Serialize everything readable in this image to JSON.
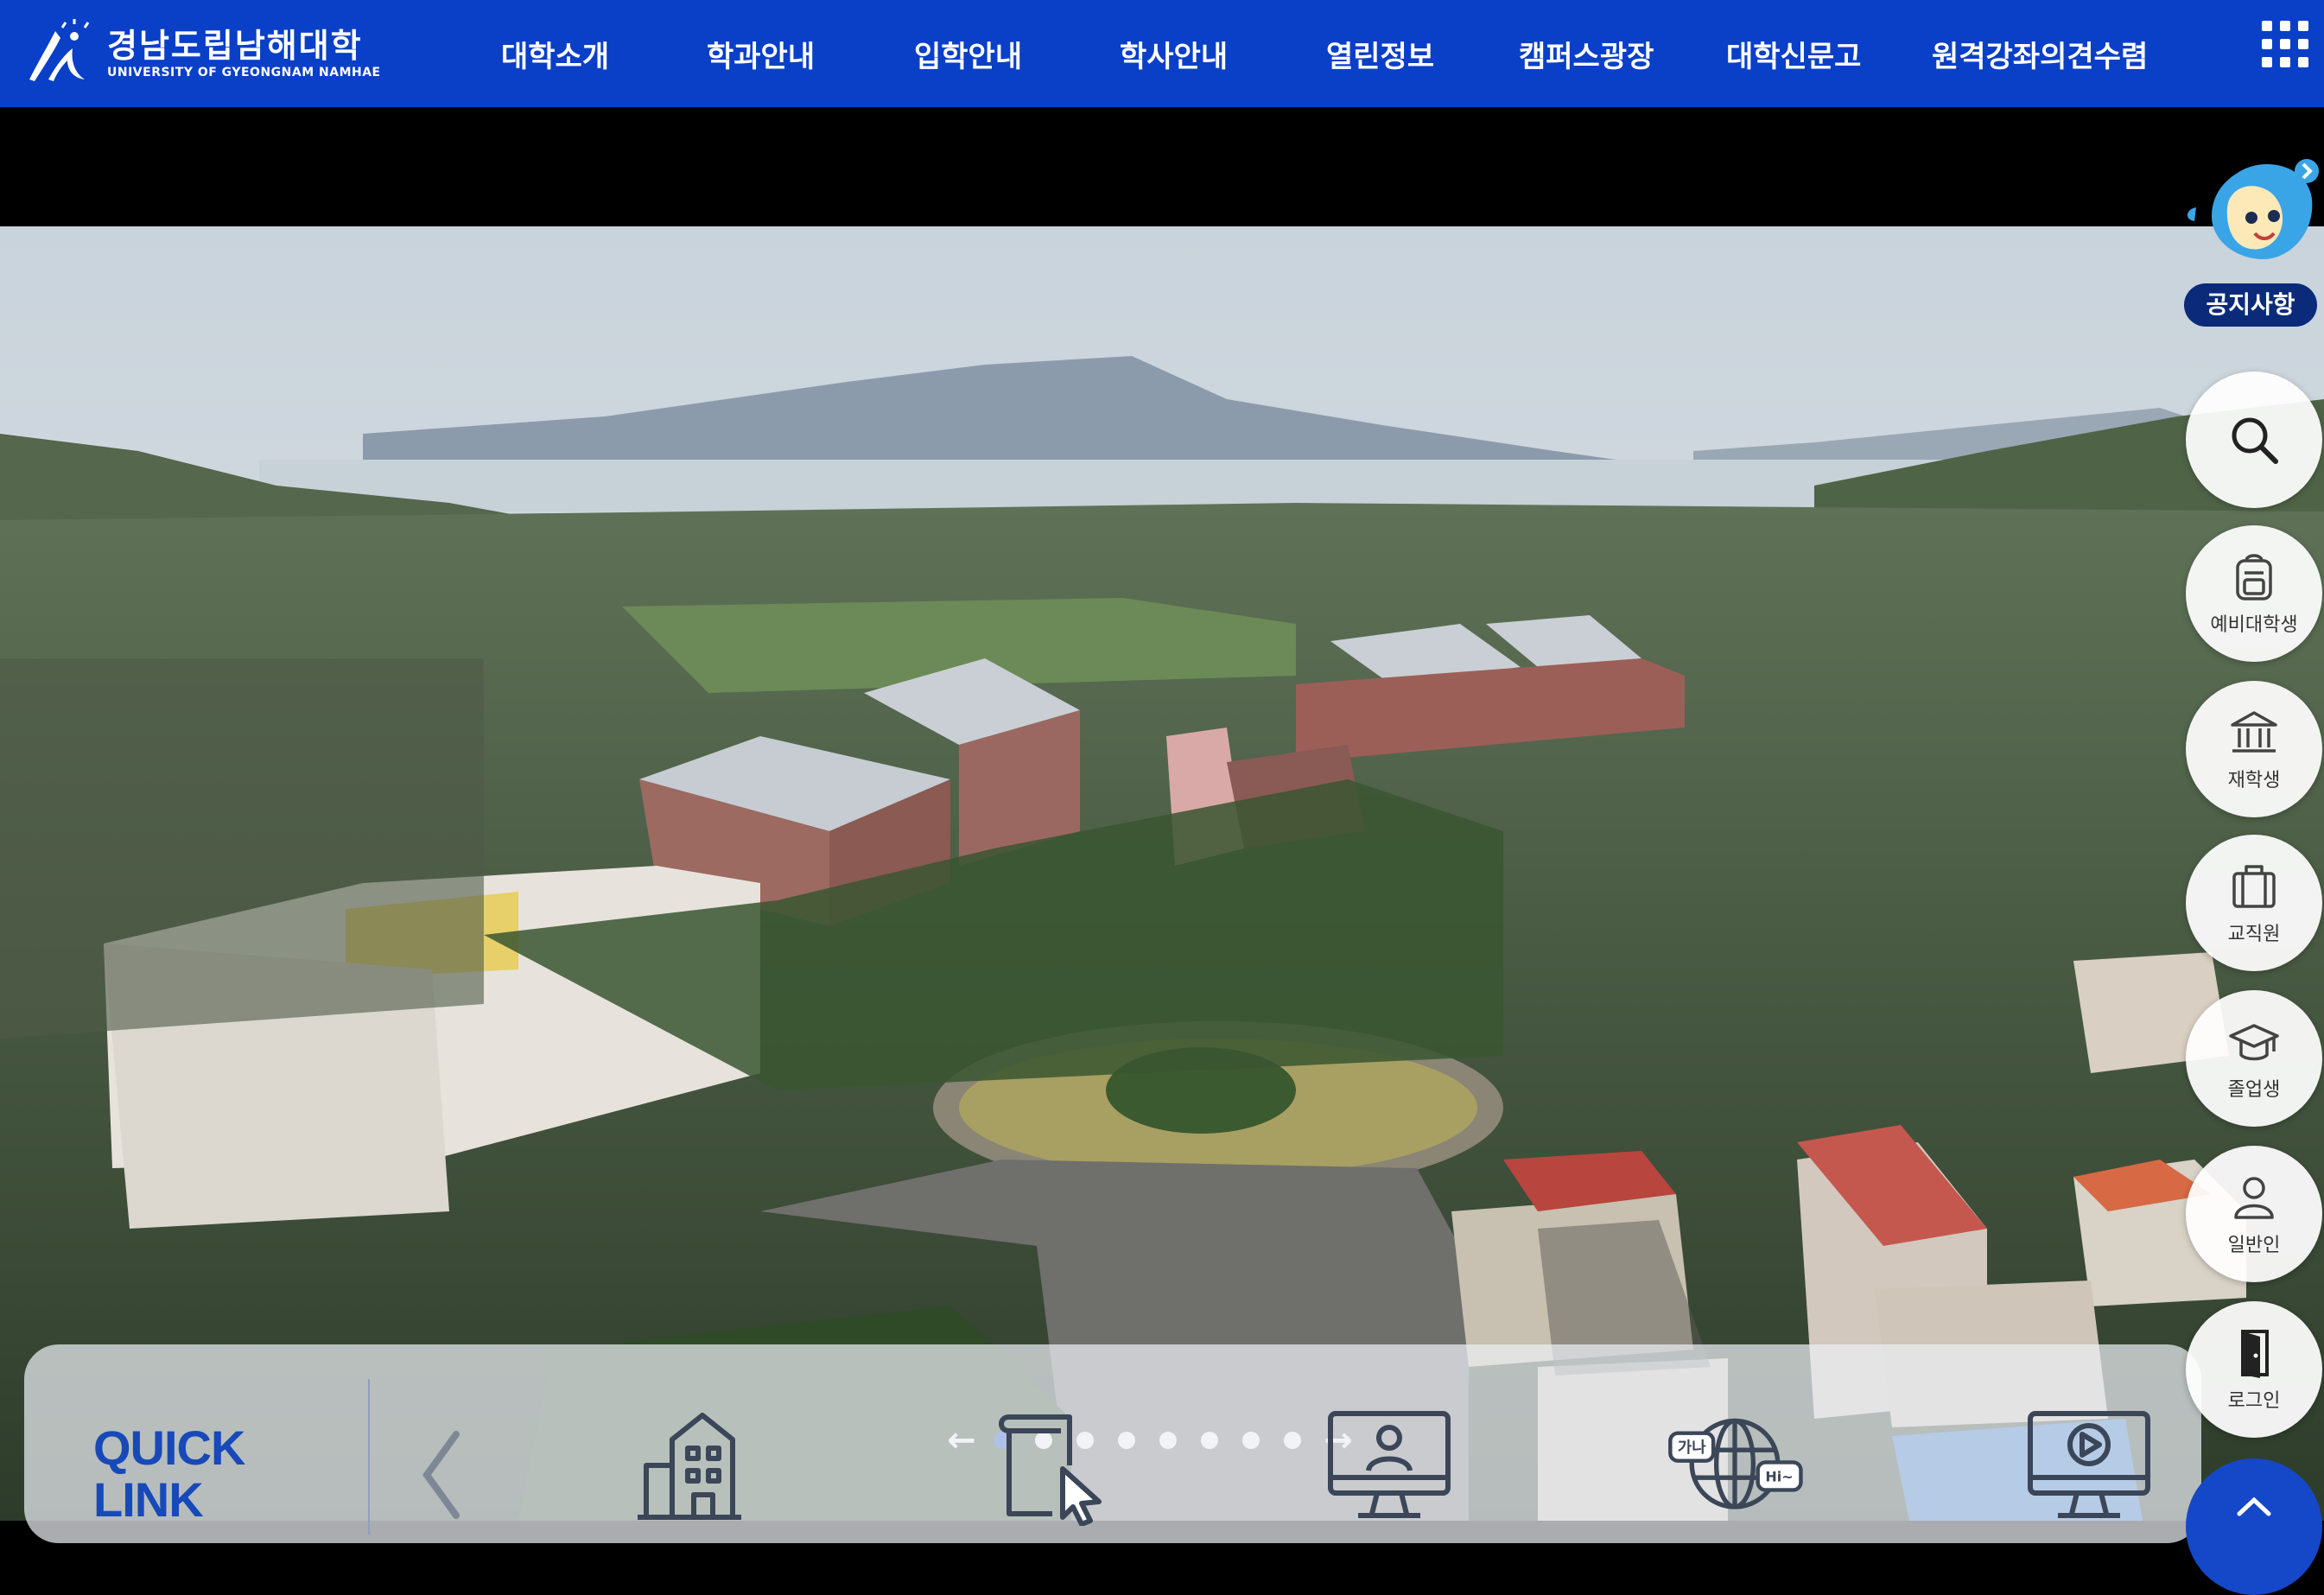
{
  "header": {
    "logo_kr": "경남도립남해대학",
    "logo_en": "UNIVERSITY OF GYEONGNAM NAMHAE",
    "nav": [
      "대학소개",
      "학과안내",
      "입학안내",
      "학사안내",
      "열린정보",
      "캠퍼스광장",
      "대학신문고",
      "원격강좌의견수렴"
    ],
    "menu_icon": "grid-menu-icon"
  },
  "hero": {
    "slides_total": 8,
    "active_slide": 1,
    "prev_arrow": "←",
    "next_arrow": "→"
  },
  "quick_link": {
    "title_line1": "QUICK",
    "title_line2": "LINK",
    "items": [
      "building-icon",
      "document-cursor-icon",
      "monitor-user-icon",
      "globe-language-icon",
      "monitor-play-icon"
    ],
    "globe_left_text": "가나",
    "globe_right_text": "Hi~"
  },
  "side": {
    "notice_label": "공지사항",
    "buttons": [
      {
        "label": "",
        "icon": "search-icon"
      },
      {
        "label": "예비대학생",
        "icon": "backpack-icon"
      },
      {
        "label": "재학생",
        "icon": "university-icon"
      },
      {
        "label": "교직원",
        "icon": "briefcase-icon"
      },
      {
        "label": "졸업생",
        "icon": "graduation-cap-icon"
      },
      {
        "label": "일반인",
        "icon": "person-icon"
      },
      {
        "label": "로그인",
        "icon": "login-door-icon"
      }
    ],
    "top_icon": "chevron-up-icon"
  },
  "colors": {
    "brand": "#0a3fc8",
    "accent_dark": "#0b2b7a",
    "quick_title": "#1849b8"
  }
}
